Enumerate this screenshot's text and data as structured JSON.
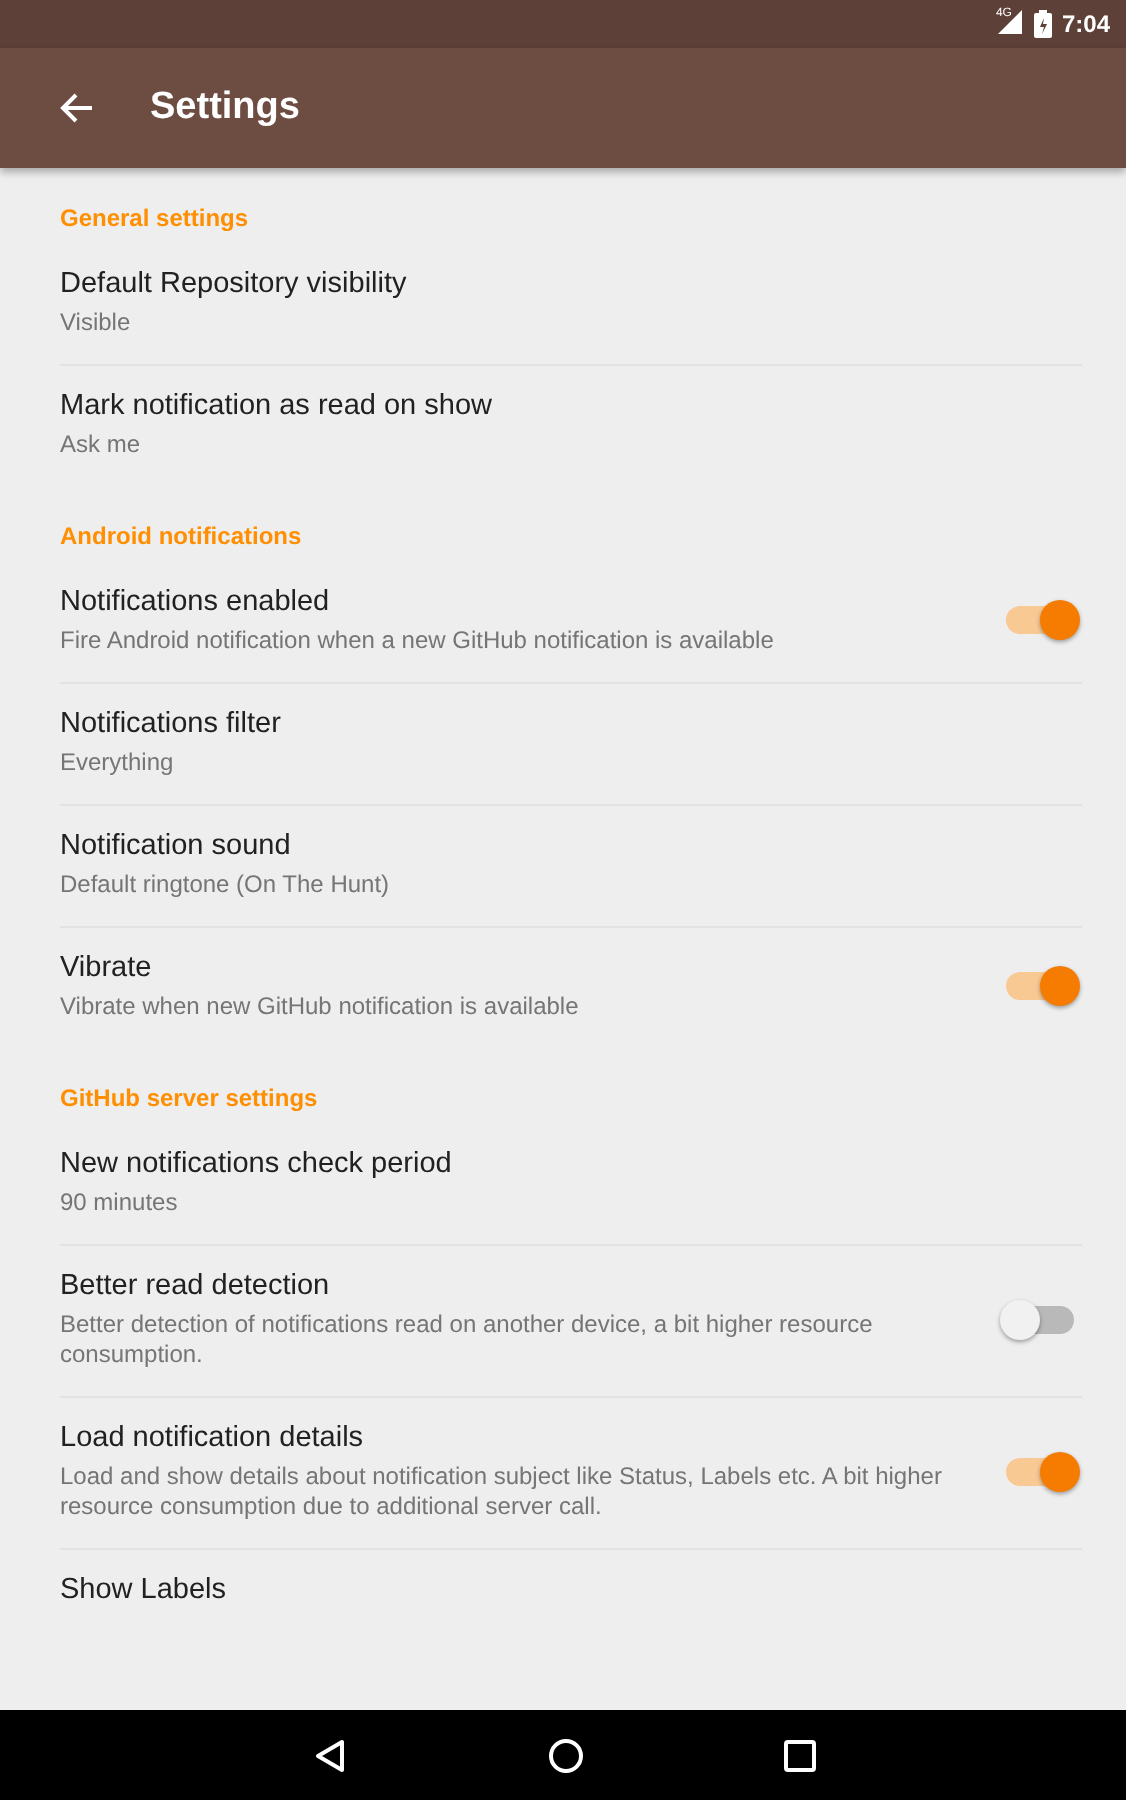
{
  "status_bar": {
    "network": "4G",
    "time": "7:04"
  },
  "app_bar": {
    "title": "Settings"
  },
  "sections": [
    {
      "title": "General settings",
      "items": [
        {
          "kind": "text",
          "title": "Default Repository visibility",
          "summary": "Visible"
        },
        {
          "kind": "text",
          "title": "Mark notification as read on show",
          "summary": "Ask me"
        }
      ]
    },
    {
      "title": "Android notifications",
      "items": [
        {
          "kind": "switch",
          "title": "Notifications enabled",
          "summary": "Fire Android notification when a new GitHub notification is available",
          "on": true
        },
        {
          "kind": "text",
          "title": "Notifications filter",
          "summary": "Everything"
        },
        {
          "kind": "text",
          "title": "Notification sound",
          "summary": "Default ringtone (On The Hunt)"
        },
        {
          "kind": "switch",
          "title": "Vibrate",
          "summary": "Vibrate when new GitHub notification is available",
          "on": true
        }
      ]
    },
    {
      "title": "GitHub server settings",
      "items": [
        {
          "kind": "text",
          "title": "New notifications check period",
          "summary": "90 minutes"
        },
        {
          "kind": "switch",
          "title": "Better read detection",
          "summary": "Better detection of notifications read on another device, a bit higher resource consumption.",
          "on": false
        },
        {
          "kind": "switch",
          "title": "Load notification details",
          "summary": "Load and show details about notification subject like Status, Labels etc. A bit higher resource consumption due to additional server call.",
          "on": true
        },
        {
          "kind": "text",
          "title": "Show Labels"
        }
      ]
    }
  ]
}
